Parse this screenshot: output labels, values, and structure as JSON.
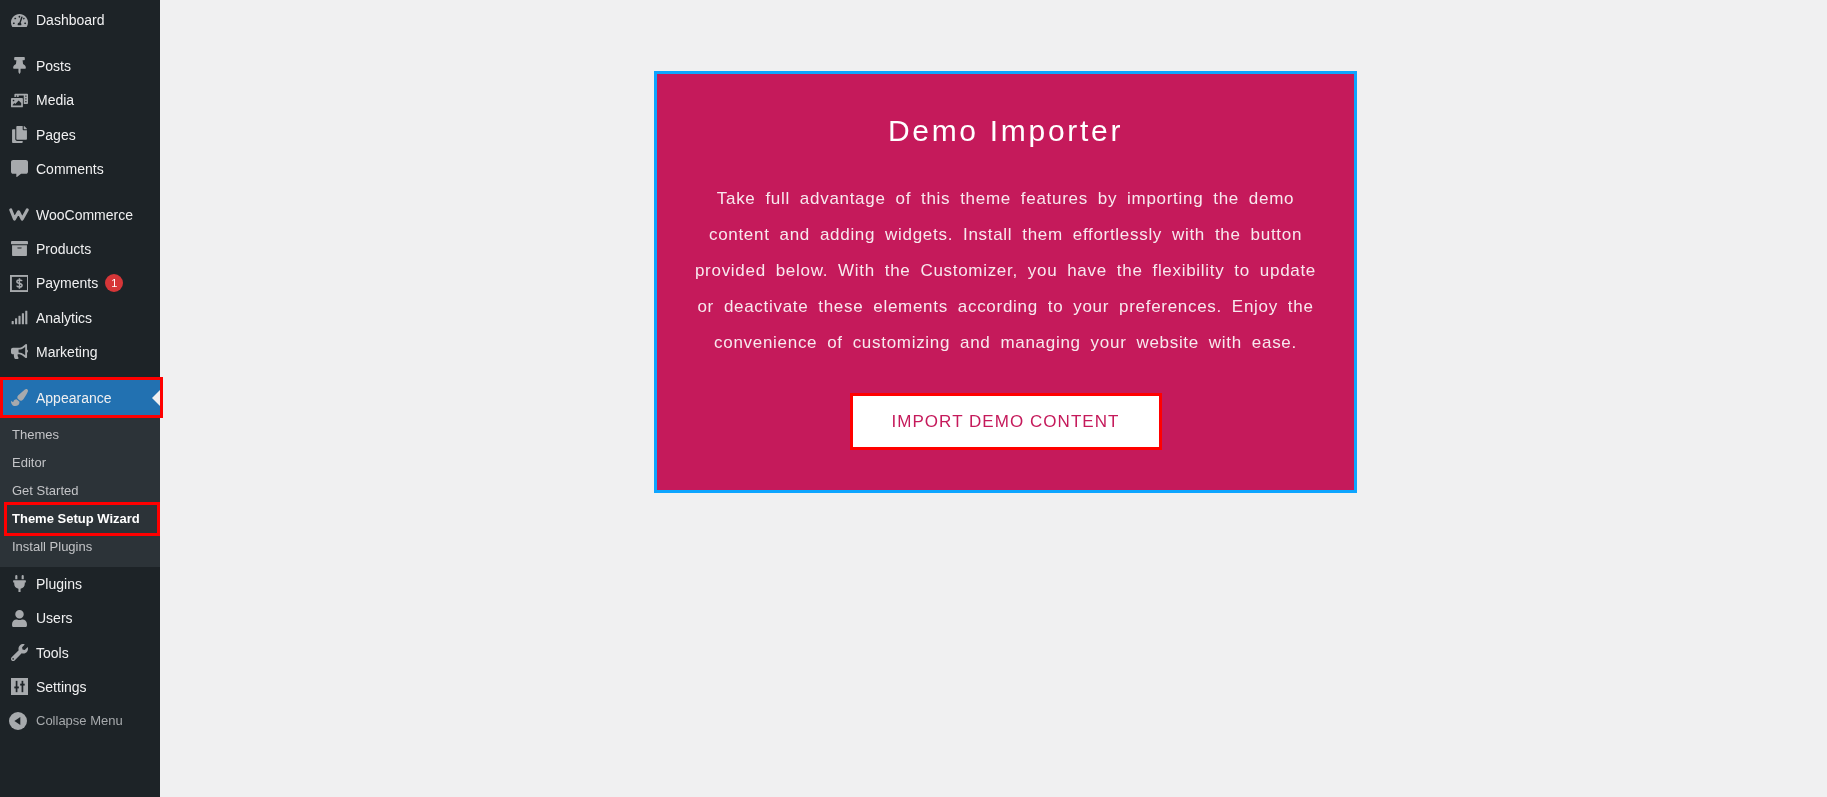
{
  "sidebar": {
    "groups": [
      {
        "items": [
          {
            "label": "Dashboard",
            "selected": false,
            "highlighted": false
          }
        ]
      },
      {
        "items": [
          {
            "label": "Posts",
            "selected": false,
            "highlighted": false
          },
          {
            "label": "Media",
            "selected": false,
            "highlighted": false
          },
          {
            "label": "Pages",
            "selected": false,
            "highlighted": false
          },
          {
            "label": "Comments",
            "selected": false,
            "highlighted": false
          }
        ]
      },
      {
        "items": [
          {
            "label": "WooCommerce",
            "selected": false,
            "highlighted": false
          },
          {
            "label": "Products",
            "selected": false,
            "highlighted": false
          },
          {
            "label": "Payments",
            "selected": false,
            "highlighted": false,
            "badge": "1"
          },
          {
            "label": "Analytics",
            "selected": false,
            "highlighted": false
          },
          {
            "label": "Marketing",
            "selected": false,
            "highlighted": false
          }
        ]
      },
      {
        "items": [
          {
            "label": "Appearance",
            "selected": true,
            "highlighted": true,
            "children": [
              {
                "label": "Themes",
                "selected": false,
                "highlighted": false
              },
              {
                "label": "Editor",
                "selected": false,
                "highlighted": false
              },
              {
                "label": "Get Started",
                "selected": false,
                "highlighted": false
              },
              {
                "label": "Theme Setup Wizard",
                "selected": true,
                "highlighted": true
              },
              {
                "label": "Install Plugins",
                "selected": false,
                "highlighted": false
              }
            ]
          },
          {
            "label": "Plugins",
            "selected": false,
            "highlighted": false
          },
          {
            "label": "Users",
            "selected": false,
            "highlighted": false
          },
          {
            "label": "Tools",
            "selected": false,
            "highlighted": false
          },
          {
            "label": "Settings",
            "selected": false,
            "highlighted": false
          }
        ]
      }
    ],
    "collapse_label": "Collapse Menu"
  },
  "importer": {
    "title": "Demo Importer",
    "description": "Take full advantage of this theme features by importing the demo content and adding widgets. Install them effortlessly with the button provided below. With the Customizer, you have the flexibility to update or deactivate these elements according to your preferences. Enjoy the convenience of customizing and managing your website with ease.",
    "button": {
      "label": "IMPORT DEMO CONTENT",
      "highlighted": true
    }
  }
}
